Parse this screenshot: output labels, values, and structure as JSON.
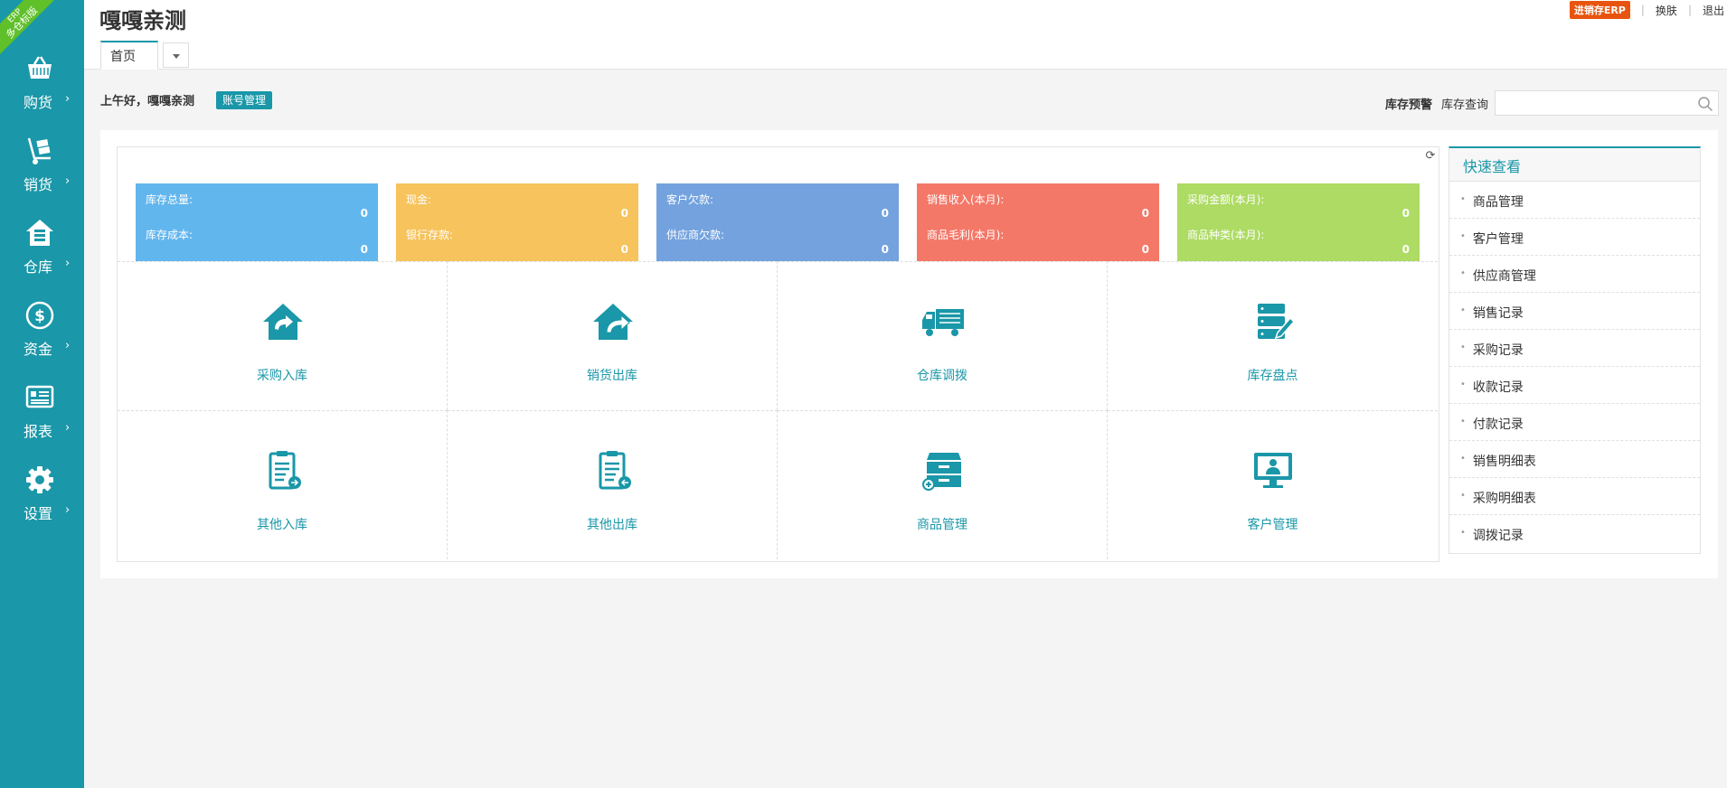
{
  "ribbon": {
    "line1": "ERP",
    "line2": "多仓标版"
  },
  "sidebar": {
    "items": [
      {
        "label": "购货",
        "icon": "basket-icon"
      },
      {
        "label": "销货",
        "icon": "handcart-icon"
      },
      {
        "label": "仓库",
        "icon": "warehouse-icon"
      },
      {
        "label": "资金",
        "icon": "dollar-icon"
      },
      {
        "label": "报表",
        "icon": "report-icon"
      },
      {
        "label": "设置",
        "icon": "gear-icon"
      }
    ],
    "arrow": "›"
  },
  "header": {
    "title": "嘎嘎亲测",
    "tab_home": "首页",
    "erp_badge": "进销存ERP",
    "skin": "换肤",
    "logout": "退出"
  },
  "greeting": {
    "text": "上午好，嘎嘎亲测",
    "account_button": "账号管理",
    "stock_warning": "库存预警",
    "stock_query": "库存查询",
    "search_placeholder": ""
  },
  "stats": [
    {
      "label1": "库存总量:",
      "value1": "0",
      "label2": "库存成本:",
      "value2": "0",
      "color": "#62b6ee"
    },
    {
      "label1": "现金:",
      "value1": "0",
      "label2": "银行存款:",
      "value2": "0",
      "color": "#f6c35c"
    },
    {
      "label1": "客户欠款:",
      "value1": "0",
      "label2": "供应商欠款:",
      "value2": "0",
      "color": "#73a2de"
    },
    {
      "label1": "销售收入(本月):",
      "value1": "0",
      "label2": "商品毛利(本月):",
      "value2": "0",
      "color": "#f47868"
    },
    {
      "label1": "采购金额(本月):",
      "value1": "0",
      "label2": "商品种类(本月):",
      "value2": "0",
      "color": "#addb63"
    }
  ],
  "tiles": [
    {
      "label": "采购入库",
      "icon": "house-inbound-icon"
    },
    {
      "label": "销货出库",
      "icon": "house-outbound-icon"
    },
    {
      "label": "仓库调拨",
      "icon": "truck-icon"
    },
    {
      "label": "库存盘点",
      "icon": "inventory-check-icon"
    },
    {
      "label": "其他入库",
      "icon": "clipboard-in-icon"
    },
    {
      "label": "其他出库",
      "icon": "clipboard-out-icon"
    },
    {
      "label": "商品管理",
      "icon": "cabinet-icon"
    },
    {
      "label": "客户管理",
      "icon": "monitor-user-icon"
    }
  ],
  "quick_panel": {
    "title": "快速查看",
    "items": [
      "商品管理",
      "客户管理",
      "供应商管理",
      "销售记录",
      "采购记录",
      "收款记录",
      "付款记录",
      "销售明细表",
      "采购明细表",
      "调拨记录"
    ]
  },
  "colors": {
    "accent": "#1a97a8",
    "badge": "#e8540f",
    "ribbon": "#5fc02a"
  }
}
